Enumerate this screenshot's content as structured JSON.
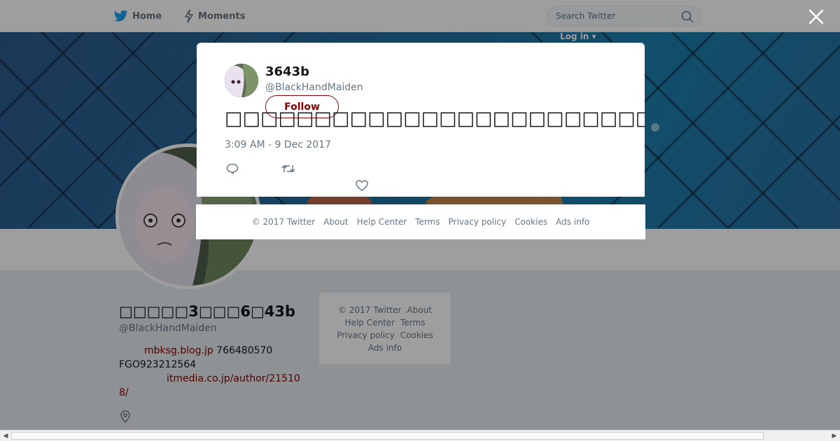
{
  "nav": {
    "home_label": "Home",
    "moments_label": "Moments",
    "search_placeholder": "Search Twitter",
    "login_label": "Log in ▾"
  },
  "profile": {
    "name": "□□□□□3□□□6□43b",
    "handle": "@BlackHandMaiden",
    "bio_line1_link": "mbksg.blog.jp",
    "bio_line1_rest": " 766480570",
    "bio_line2": "FGO923212564",
    "bio_line3_link": "itmedia.co.jp/author/21510",
    "bio_line4_link": "8/"
  },
  "side_footer": {
    "items": [
      "© 2017 Twitter",
      "About",
      "Help Center",
      "Terms",
      "Privacy policy",
      "Cookies",
      "Ads info"
    ]
  },
  "modal": {
    "name": "3643b",
    "handle": "@BlackHandMaiden",
    "follow_label": "Follow",
    "tweet_text": "□□□□□□□□□□□□□□□□□□□□□□□□□□□□□□□□GoogleIME□□□□□□□□□□□□□□□□□□□□",
    "timestamp": "3:09 AM - 9 Dec 2017"
  },
  "modal_footer": {
    "items": [
      "© 2017 Twitter",
      "About",
      "Help Center",
      "Terms",
      "Privacy policy",
      "Cookies",
      "Ads info"
    ]
  },
  "colors": {
    "accent": "#8b0000",
    "twitter_blue": "#1da1f2",
    "banner": "#236e9c"
  }
}
